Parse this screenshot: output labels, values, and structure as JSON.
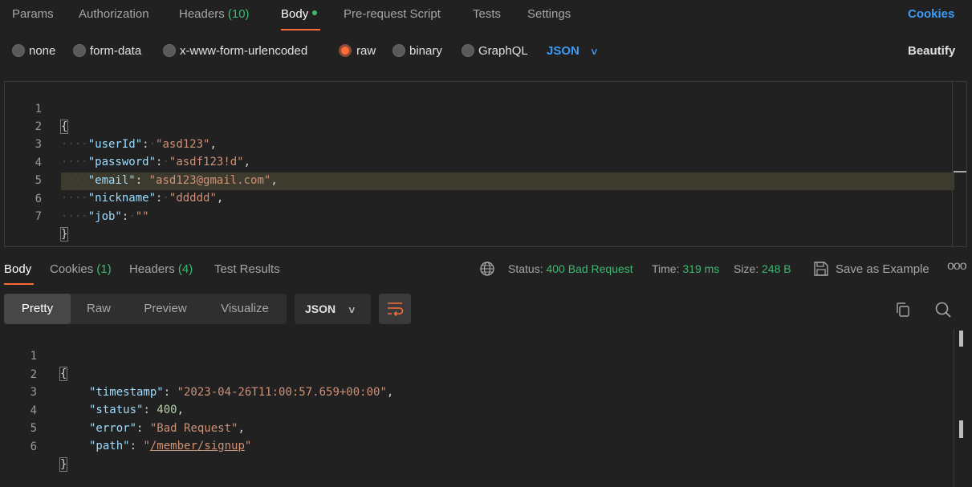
{
  "request_tabs": {
    "params": "Params",
    "authorization": "Authorization",
    "headers_label": "Headers",
    "headers_count": "(10)",
    "body": "Body",
    "pre_request": "Pre-request Script",
    "tests": "Tests",
    "settings": "Settings",
    "cookies": "Cookies"
  },
  "body_types": {
    "none": "none",
    "form_data": "form-data",
    "urlencoded": "x-www-form-urlencoded",
    "raw": "raw",
    "binary": "binary",
    "graphql": "GraphQL",
    "selected": "raw",
    "language": "JSON",
    "beautify": "Beautify"
  },
  "request_body": {
    "line_numbers": [
      "1",
      "2",
      "3",
      "4",
      "5",
      "6",
      "7"
    ],
    "open_brace": "{",
    "close_brace": "}",
    "fields": [
      {
        "key": "\"userId\"",
        "value": "\"asd123\"",
        "comma": ","
      },
      {
        "key": "\"password\"",
        "value": "\"asdf123!d\"",
        "comma": ","
      },
      {
        "key": "\"email\"",
        "value": "\"asd123@gmail.com\"",
        "comma": ","
      },
      {
        "key": "\"nickname\"",
        "value": "\"ddddd\"",
        "comma": ","
      },
      {
        "key": "\"job\"",
        "value": "\"\"",
        "comma": ""
      }
    ],
    "highlighted_line": 6
  },
  "response_tabs": {
    "body": "Body",
    "cookies_label": "Cookies",
    "cookies_count": "(1)",
    "headers_label": "Headers",
    "headers_count": "(4)",
    "test_results": "Test Results"
  },
  "response_status": {
    "status_label": "Status:",
    "status_value": "400 Bad Request",
    "time_label": "Time:",
    "time_value": "319 ms",
    "size_label": "Size:",
    "size_value": "248 B",
    "save_example": "Save as Example",
    "more": "ooo"
  },
  "view_modes": {
    "pretty": "Pretty",
    "raw": "Raw",
    "preview": "Preview",
    "visualize": "Visualize",
    "active": "Pretty",
    "format": "JSON"
  },
  "response_body": {
    "line_numbers": [
      "1",
      "2",
      "3",
      "4",
      "5",
      "6"
    ],
    "open_brace": "{",
    "close_brace": "}",
    "timestamp_key": "\"timestamp\"",
    "timestamp_value": "\"2023-04-26T11:00:57.659+00:00\"",
    "status_key": "\"status\"",
    "status_value": "400",
    "error_key": "\"error\"",
    "error_value": "\"Bad Request\"",
    "path_key": "\"path\"",
    "path_quote": "\"",
    "path_value": "/member/signup"
  },
  "colors": {
    "accent_orange": "#ff6c37",
    "link_blue": "#3c9cf5",
    "status_green": "#3fb871",
    "json_key": "#9cdcfe",
    "json_string": "#ce9178",
    "json_number": "#b5cea8",
    "background": "#212121"
  }
}
